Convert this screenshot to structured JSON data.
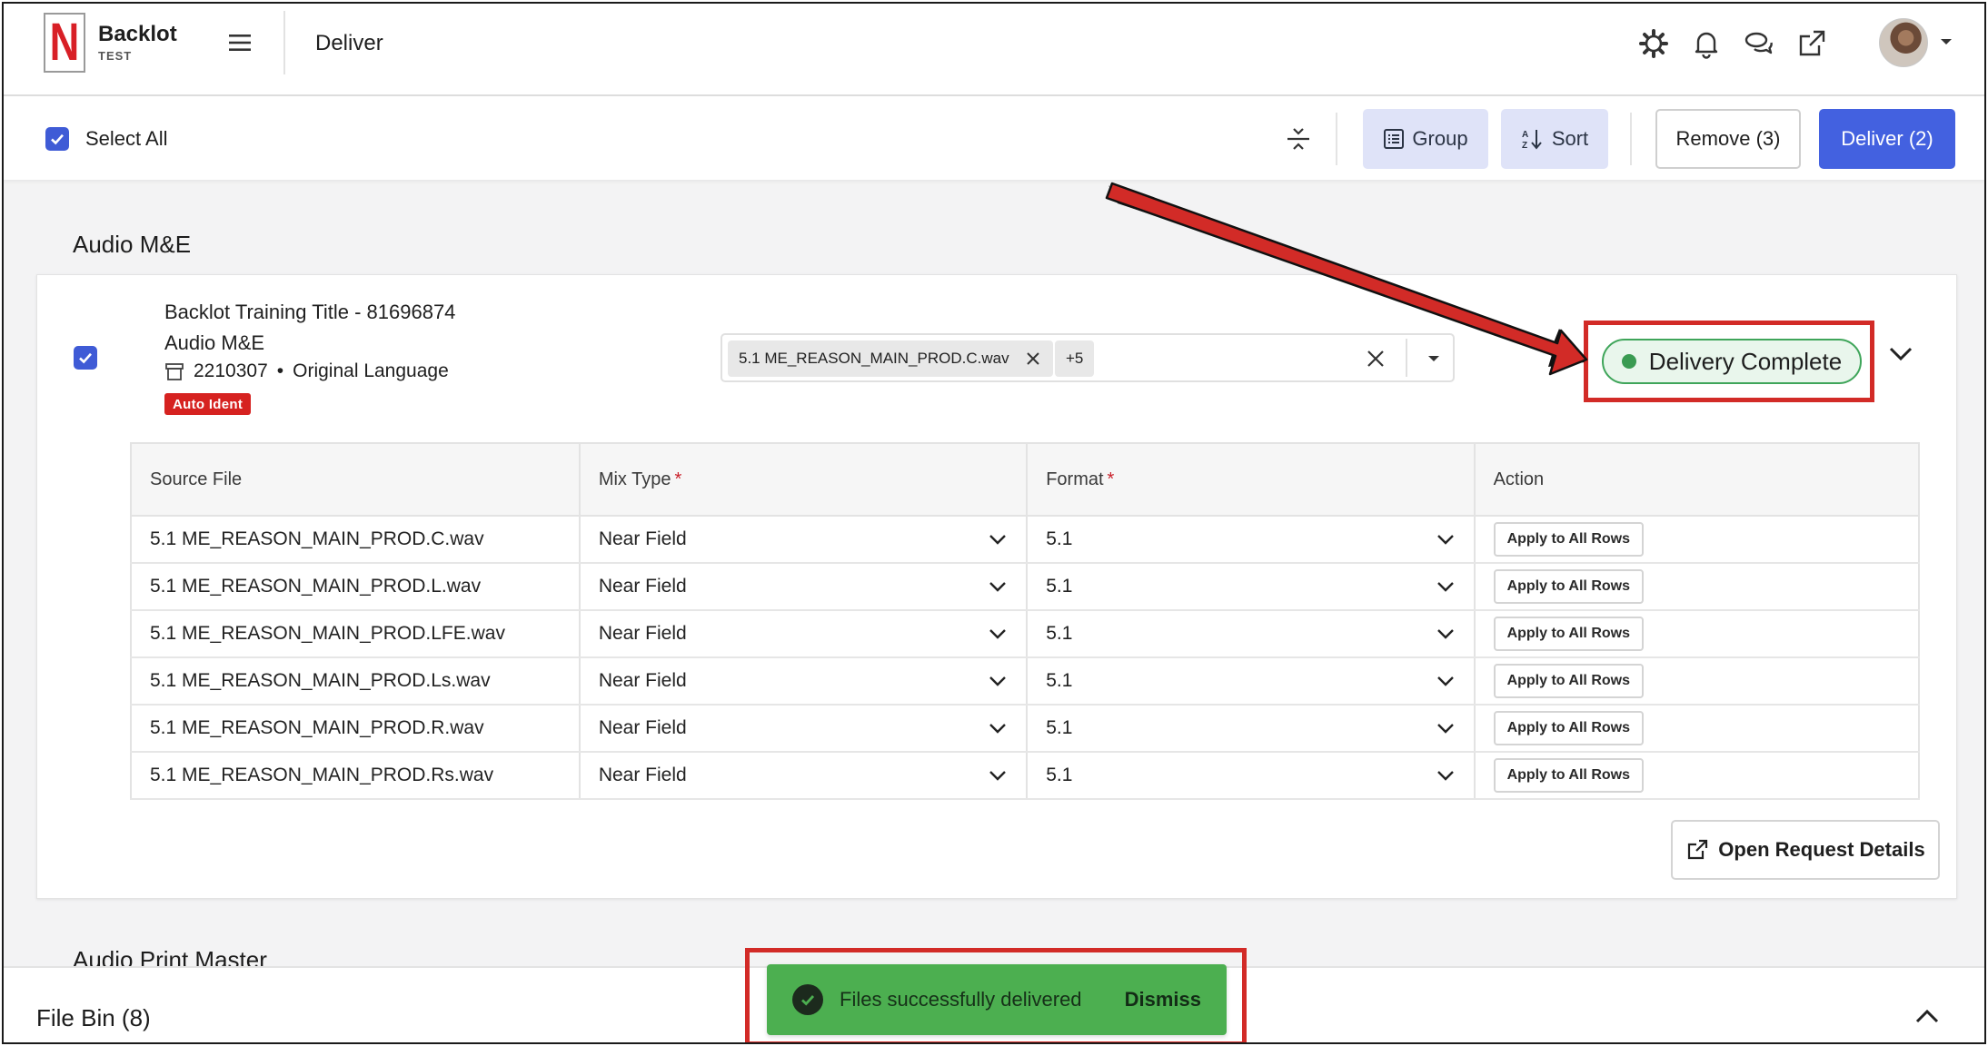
{
  "header": {
    "logo_letter": "N",
    "brand_name": "Backlot",
    "brand_env": "TEST",
    "page_title": "Deliver",
    "icons": [
      "settings-icon",
      "bell-icon",
      "chat-icon",
      "external-link-icon"
    ]
  },
  "toolbar": {
    "select_all_label": "Select All",
    "select_all_checked": true,
    "group_label": "Group",
    "sort_label": "Sort",
    "remove_label": "Remove (3)",
    "deliver_label": "Deliver (2)"
  },
  "sections": [
    {
      "title": "Audio M&E",
      "item": {
        "title": "Backlot Training Title - 81696874",
        "type": "Audio M&E",
        "request_id": "2210307",
        "language": "Original Language",
        "meta_separator": "•",
        "badge": "Auto Ident",
        "checked": true,
        "selected_file_chip": "5.1 ME_REASON_MAIN_PROD.C.wav",
        "more_chip": "+5",
        "status": "Delivery Complete",
        "table": {
          "headers": [
            "Source File",
            "Mix Type",
            "Format",
            "Action"
          ],
          "required_marker": "*",
          "rows": [
            {
              "file": "5.1 ME_REASON_MAIN_PROD.C.wav",
              "mix": "Near Field",
              "format": "5.1",
              "action": "Apply to All Rows"
            },
            {
              "file": "5.1 ME_REASON_MAIN_PROD.L.wav",
              "mix": "Near Field",
              "format": "5.1",
              "action": "Apply to All Rows"
            },
            {
              "file": "5.1 ME_REASON_MAIN_PROD.LFE.wav",
              "mix": "Near Field",
              "format": "5.1",
              "action": "Apply to All Rows"
            },
            {
              "file": "5.1 ME_REASON_MAIN_PROD.Ls.wav",
              "mix": "Near Field",
              "format": "5.1",
              "action": "Apply to All Rows"
            },
            {
              "file": "5.1 ME_REASON_MAIN_PROD.R.wav",
              "mix": "Near Field",
              "format": "5.1",
              "action": "Apply to All Rows"
            },
            {
              "file": "5.1 ME_REASON_MAIN_PROD.Rs.wav",
              "mix": "Near Field",
              "format": "5.1",
              "action": "Apply to All Rows"
            }
          ]
        },
        "open_request_label": "Open Request Details"
      }
    },
    {
      "title": "Audio Print Master"
    }
  ],
  "file_bin": {
    "label": "File Bin (8)"
  },
  "toast": {
    "message": "Files successfully delivered",
    "dismiss_label": "Dismiss"
  },
  "colors": {
    "primary": "#4361e0",
    "soft_button": "#dfe3f8",
    "status_green": "#3a9b52",
    "toast_green": "#4caf50",
    "badge_red": "#d62220",
    "annotation_red": "#d22b27"
  }
}
